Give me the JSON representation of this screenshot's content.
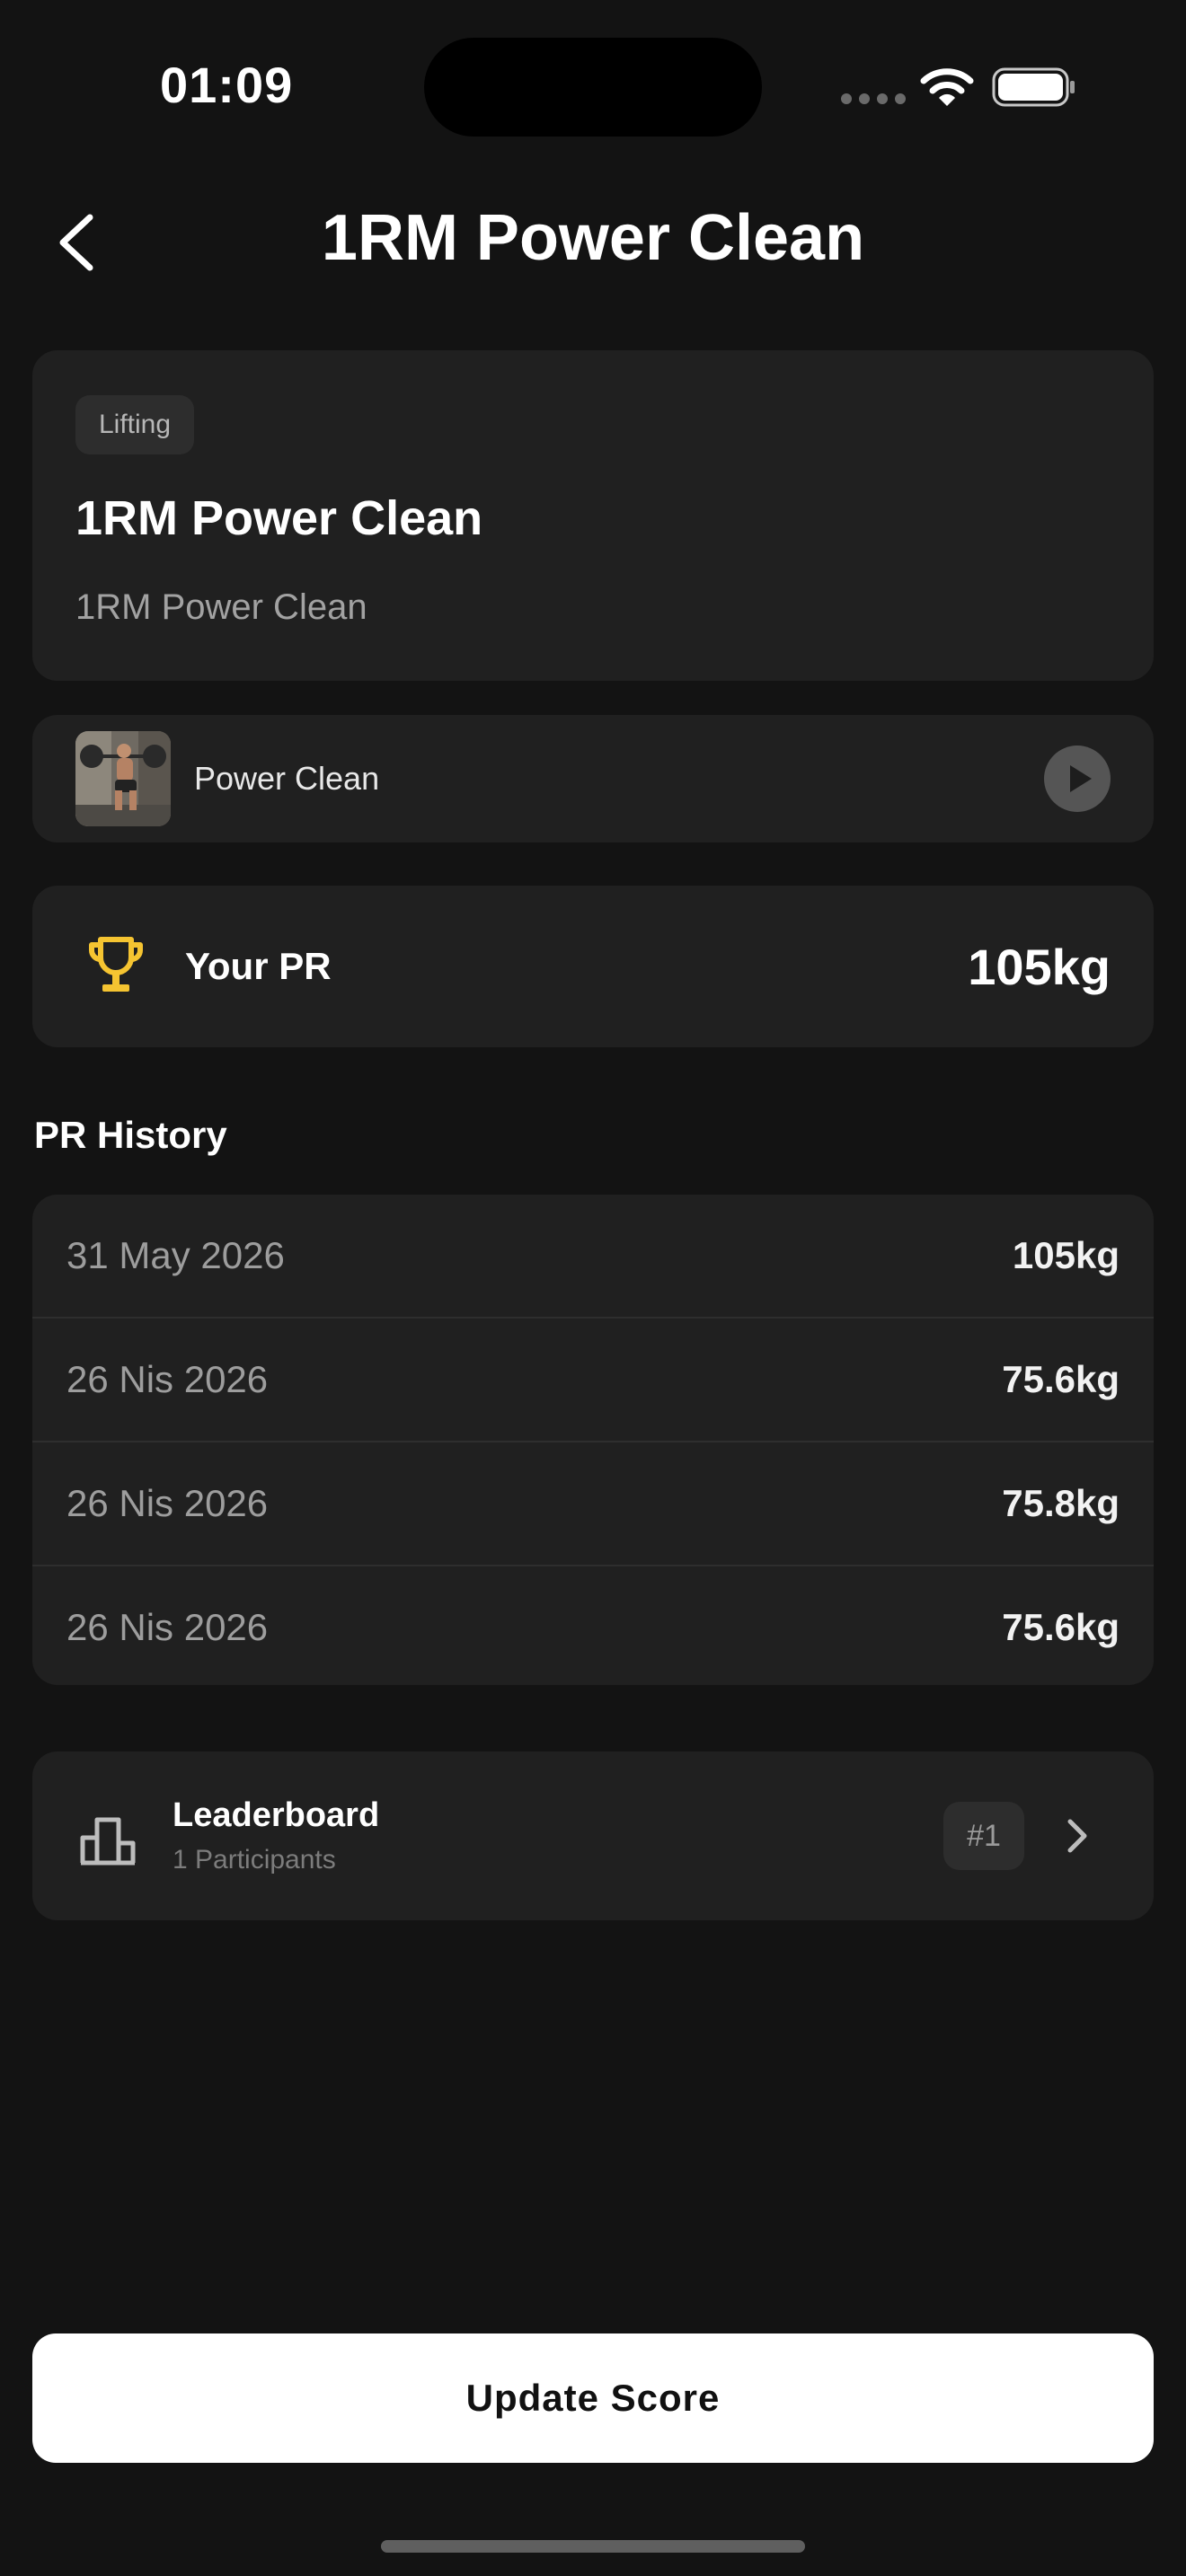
{
  "status_bar": {
    "time": "01:09"
  },
  "header": {
    "title": "1RM Power Clean"
  },
  "workout": {
    "tag": "Lifting",
    "title": "1RM Power Clean",
    "description": "1RM Power Clean"
  },
  "movement": {
    "label": "Power Clean"
  },
  "pr": {
    "label": "Your PR",
    "value": "105kg"
  },
  "history": {
    "title": "PR History",
    "rows": [
      {
        "date": "31 May 2026",
        "value": "105kg"
      },
      {
        "date": "26 Nis 2026",
        "value": "75.6kg"
      },
      {
        "date": "26 Nis 2026",
        "value": "75.8kg"
      },
      {
        "date": "26 Nis 2026",
        "value": "75.6kg"
      }
    ]
  },
  "leaderboard": {
    "title": "Leaderboard",
    "subtitle": "1 Participants",
    "rank": "#1"
  },
  "actions": {
    "update_label": "Update Score"
  },
  "colors": {
    "background": "#131313",
    "card": "#202020",
    "trophy": "#f5c431",
    "button": "#ffffff"
  }
}
